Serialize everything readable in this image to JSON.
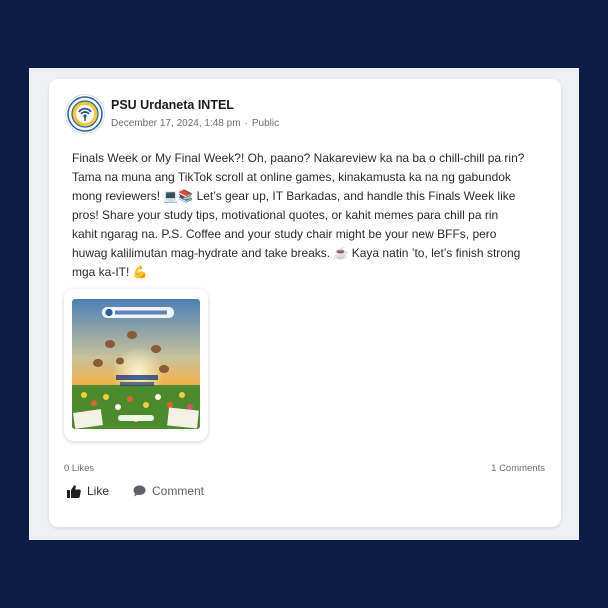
{
  "post": {
    "author": "PSU Urdaneta INTEL",
    "date": "December 17, 2024, 1:48 pm",
    "visibility": "Public",
    "text": "Finals Week or My Final Week?! Oh, paano? Nakareview ka na ba o chill-chill pa rin?\nTama na muna ang TikTok scroll at online games, kinakamusta ka na ng gabundok\nmong reviewers! 💻📚 Let’s gear up, IT Barkadas, and handle this Finals Week like\npros! Share your study tips, motivational quotes, or kahit memes para chill pa rin\nkahit ngarag na. P.S. Coffee and your study chair might be your new BFFs, pero\nhuwag kalilimutan mag-hydrate and take breaks. ☕ Kaya natin ’to, let’s finish strong\nmga ka-IT! 💪",
    "likes": "0 Likes",
    "comments": "1 Comments"
  },
  "attachment": {
    "banner_text": "Information Technologist League",
    "caption": "Kaya natin 'to",
    "icon": "image-thumbnail"
  },
  "actions": {
    "like_label": "Like",
    "comment_label": "Comment",
    "like_icon": "thumbs-up-icon",
    "comment_icon": "speech-bubble-icon"
  },
  "colors": {
    "background": "#0b1d45",
    "panel": "#eef0f3",
    "card": "#ffffff"
  }
}
